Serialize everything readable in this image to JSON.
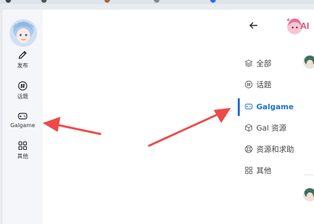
{
  "sidebar": {
    "items": [
      {
        "label": "发布",
        "icon": "pencil-icon"
      },
      {
        "label": "话题",
        "icon": "hashtag-icon"
      },
      {
        "label": "Galgame",
        "icon": "gamepad-icon"
      },
      {
        "label": "其他",
        "icon": "grid-icon"
      }
    ]
  },
  "header": {
    "brand_text": "AI"
  },
  "categories": [
    {
      "label": "全部",
      "icon": "layers-icon",
      "active": false
    },
    {
      "label": "话题",
      "icon": "hashtag-circle-icon",
      "active": false
    },
    {
      "label": "Galgame",
      "icon": "gamepad-icon",
      "active": true
    },
    {
      "label": "Gal 资源",
      "icon": "cube-icon",
      "active": false
    },
    {
      "label": "资源和求助",
      "icon": "lifebuoy-icon",
      "active": false
    },
    {
      "label": "其他",
      "icon": "grid-icon",
      "active": false
    }
  ],
  "colors": {
    "accent": "#1f6fd1",
    "annotation_arrow": "#ee4a4a",
    "brand_pink": "#e3547a"
  }
}
